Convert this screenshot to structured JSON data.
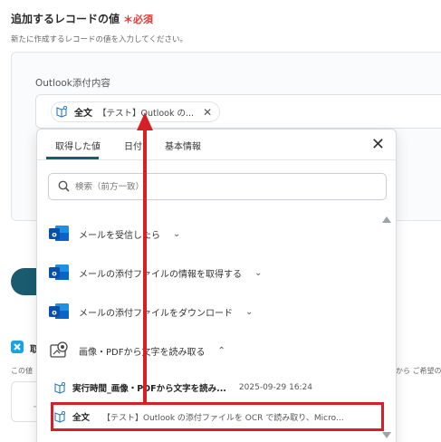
{
  "section": {
    "title": "追加するレコードの値",
    "required_mark": "＊必須",
    "description": "新たに作成するレコードの値を入力してください。"
  },
  "field": {
    "label": "Outlook添付内容",
    "chip": {
      "name": "全文",
      "value": "【テスト】Outlook の..."
    }
  },
  "dropdown": {
    "tabs": [
      "取得した値",
      "日付",
      "基本情報"
    ],
    "active_tab": "取得した値",
    "search_placeholder": "検索（前方一致）",
    "steps": [
      {
        "label": "メールを受信したら",
        "icon": "outlook-icon"
      },
      {
        "label": "メールの添付ファイルの情報を取得する",
        "icon": "outlook-icon"
      },
      {
        "label": "メールの添付ファイルをダウンロード",
        "icon": "outlook-icon"
      },
      {
        "label": "画像・PDFから文字を読み取る",
        "icon": "ocr-icon"
      }
    ],
    "results": [
      {
        "name": "実行時間_画像・PDFから文字を読み...",
        "value": "2025-09-29 16:24"
      },
      {
        "name": "全文",
        "value": "【テスト】Outlook の添付ファイルを OCR で読み取り、Micro..."
      }
    ]
  },
  "background": {
    "bottom_label_partial": "取",
    "bottom_desc_left": "この値",
    "bottom_desc_right": "から ご希望の",
    "bottom_box_text": "ー"
  },
  "colors": {
    "accent": "#1b5b70",
    "required": "#e53935",
    "annotation_red": "#d61f26",
    "outlook_blue": "#0a64c8"
  }
}
